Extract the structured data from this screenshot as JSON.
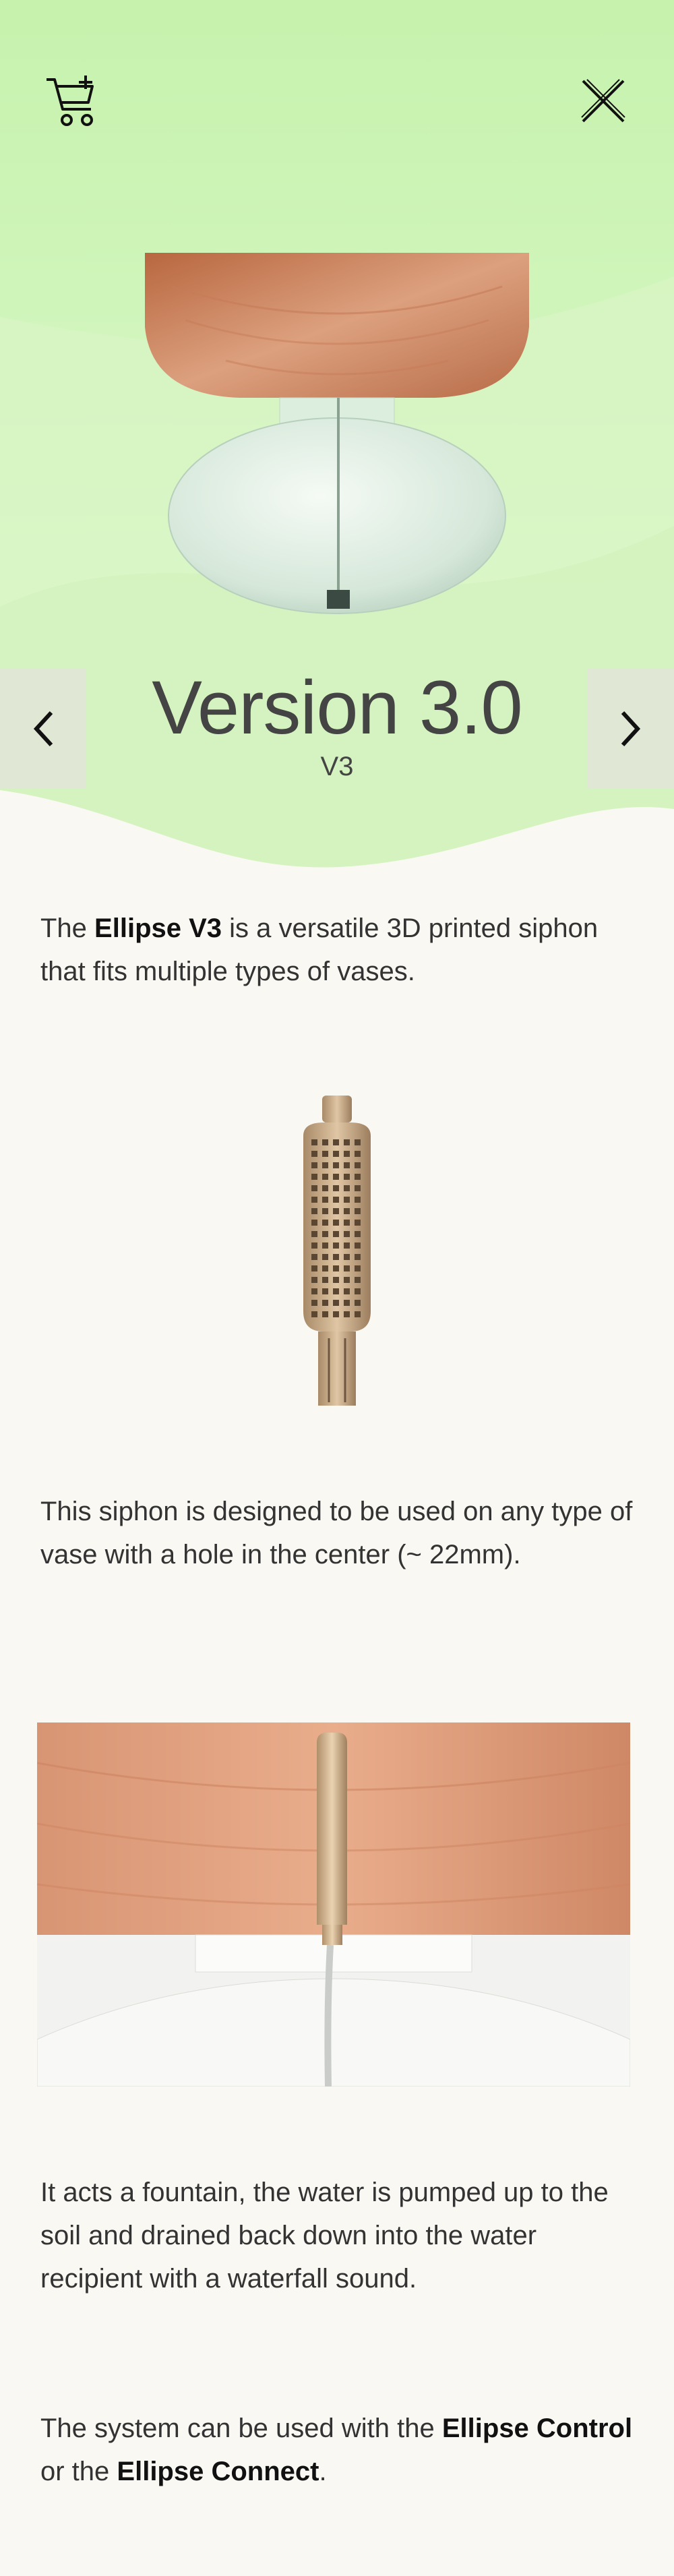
{
  "header": {
    "cart_icon": "add-to-cart-icon",
    "close_icon": "close-icon"
  },
  "hero": {
    "title": "Version 3.0",
    "subtitle": "V3",
    "prev_icon": "chevron-left-icon",
    "next_icon": "chevron-right-icon",
    "colors": {
      "background": "#c6f2ad",
      "wood": "#c98060",
      "glass": "#e8f3ea"
    }
  },
  "content": {
    "p1": {
      "a": "The ",
      "b": "Ellipse V3",
      "c": " is a versatile 3D printed siphon that fits multiple types of vases."
    },
    "p2": "This siphon is designed to be used on any type of vase with a hole in the center (~ 22mm).",
    "p3": "It acts a fountain, the water is pumped up to the soil and drained back down into the water recipient with a waterfall sound.",
    "p4": {
      "a": "The system can be used with the ",
      "b": "Ellipse Control",
      "c": " or the ",
      "d": "Ellipse Connect",
      "e": "."
    }
  }
}
